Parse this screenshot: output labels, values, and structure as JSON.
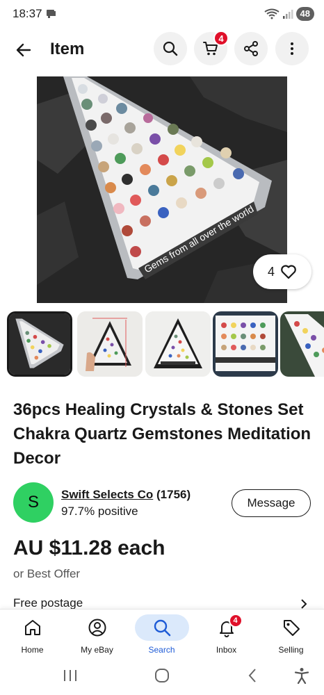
{
  "status_bar": {
    "time": "18:37",
    "battery": "48"
  },
  "header": {
    "title": "Item",
    "cart_count": "4"
  },
  "image": {
    "watch_count": "4",
    "caption": "Gems from all over the world"
  },
  "item": {
    "title": "36pcs Healing Crystals & Stones Set Chakra Quartz Gemstones Meditation Decor"
  },
  "seller": {
    "initial": "S",
    "name": "Swift Selects Co",
    "feedback_count": "(1756)",
    "positive": "97.7% positive",
    "message_label": "Message"
  },
  "pricing": {
    "price": "AU $11.28 each",
    "offer": "or Best Offer",
    "postage": "Free postage"
  },
  "bottom_nav": {
    "items": [
      {
        "label": "Home",
        "icon": "home-icon"
      },
      {
        "label": "My eBay",
        "icon": "account-icon"
      },
      {
        "label": "Search",
        "icon": "search-icon"
      },
      {
        "label": "Inbox",
        "icon": "bell-icon",
        "badge": "4"
      },
      {
        "label": "Selling",
        "icon": "tag-icon"
      }
    ]
  },
  "colors": {
    "accent": "#1e5bd6",
    "badge": "#e0102a",
    "avatar": "#2fd062"
  }
}
